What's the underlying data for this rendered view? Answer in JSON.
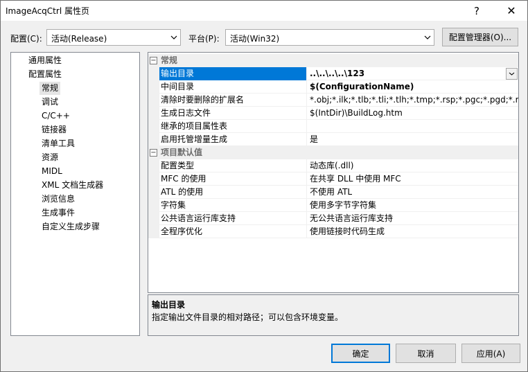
{
  "window": {
    "title": "ImageAcqCtrl 属性页",
    "help": "?",
    "close": "✕"
  },
  "toolbar": {
    "config_label": "配置(C):",
    "config_value": "活动(Release)",
    "platform_label": "平台(P):",
    "platform_value": "活动(Win32)",
    "config_manager": "配置管理器(O)..."
  },
  "tree": {
    "items": [
      "通用属性",
      "配置属性",
      "常规",
      "调试",
      "C/C++",
      "链接器",
      "清单工具",
      "资源",
      "MIDL",
      "XML 文档生成器",
      "浏览信息",
      "生成事件",
      "自定义生成步骤"
    ]
  },
  "grid": {
    "cat1": {
      "toggle": "⊟",
      "name": "常规"
    },
    "general": [
      {
        "name": "输出目录",
        "value": "..\\..\\..\\..\\123"
      },
      {
        "name": "中间目录",
        "value": "$(ConfigurationName)"
      },
      {
        "name": "清除时要删除的扩展名",
        "value": "*.obj;*.ilk;*.tlb;*.tli;*.tlh;*.tmp;*.rsp;*.pgc;*.pgd;*.meta;$"
      },
      {
        "name": "生成日志文件",
        "value": "$(IntDir)\\BuildLog.htm"
      },
      {
        "name": "继承的项目属性表",
        "value": ""
      },
      {
        "name": "启用托管增量生成",
        "value": "是"
      }
    ],
    "cat2": {
      "toggle": "⊟",
      "name": "项目默认值"
    },
    "defaults": [
      {
        "name": "配置类型",
        "value": "动态库(.dll)"
      },
      {
        "name": "MFC 的使用",
        "value": "在共享 DLL 中使用 MFC"
      },
      {
        "name": "ATL 的使用",
        "value": "不使用 ATL"
      },
      {
        "name": "字符集",
        "value": "使用多字节字符集"
      },
      {
        "name": "公共语言运行库支持",
        "value": "无公共语言运行库支持"
      },
      {
        "name": "全程序优化",
        "value": "使用链接时代码生成"
      }
    ]
  },
  "description": {
    "title": "输出目录",
    "text": "指定输出文件目录的相对路径；可以包含环境变量。"
  },
  "buttons": {
    "ok": "确定",
    "cancel": "取消",
    "apply": "应用(A)"
  },
  "colors": {
    "selection": "#0078d7",
    "tree_selection": "#e5e5e5",
    "window_bg": "#f0f0f0"
  }
}
